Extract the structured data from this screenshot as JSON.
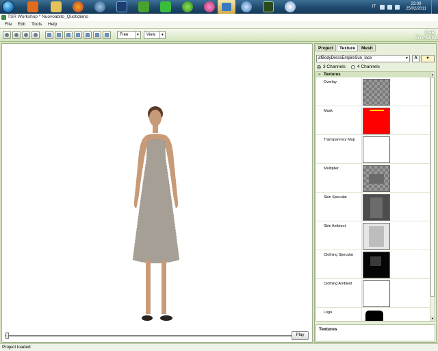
{
  "taskbar": {
    "language": "IT",
    "time": "23:09",
    "date": "25/02/2011",
    "icons": [
      "windows-start-icon",
      "media-player-icon",
      "folder-icon",
      "firefox-icon",
      "network-icon",
      "photoshop-icon",
      "sims-icon",
      "sims-green-icon",
      "green-plant-icon",
      "pink-plumbob-icon",
      "tsr-workshop-icon",
      "ie-icon",
      "w-app-icon",
      "paint-icon"
    ]
  },
  "window": {
    "title": "TSR Workshop * Nuovoabito_Quotidiano"
  },
  "menu": {
    "items": [
      "File",
      "Edit",
      "Tools",
      "Help"
    ]
  },
  "toolbar": {
    "mode_select": "Free",
    "view_select": "View",
    "logo": "TSR Workshop"
  },
  "viewport": {
    "play_label": "Play",
    "colors": {
      "dress": "#a59f96",
      "skin": "#c79a78",
      "hair": "#5a3a28"
    }
  },
  "panel": {
    "tabs": [
      "Project",
      "Texture",
      "Mesh"
    ],
    "active_tab": "Texture",
    "mesh_select": "afBodyDressEmpireSun_lace",
    "a_button": "A",
    "channels": [
      {
        "label": "3 Channels",
        "selected": true
      },
      {
        "label": "4 Channels",
        "selected": false
      }
    ],
    "section_title": "Textures",
    "rows": [
      {
        "name": "Overlay",
        "thumb": "checker"
      },
      {
        "name": "Mask",
        "thumb": "red"
      },
      {
        "name": "Transparency Map",
        "thumb": "white"
      },
      {
        "name": "Multiplier",
        "thumb": "checker-dress"
      },
      {
        "name": "Skin Specular",
        "thumb": "gray"
      },
      {
        "name": "Skin Ambient",
        "thumb": "light"
      },
      {
        "name": "Clothing Specular",
        "thumb": "black"
      },
      {
        "name": "Clothing Ambient",
        "thumb": "white"
      },
      {
        "name": "Logo",
        "thumb": "black-partial"
      }
    ],
    "description_title": "Textures"
  },
  "status": {
    "text": "Project loaded"
  }
}
